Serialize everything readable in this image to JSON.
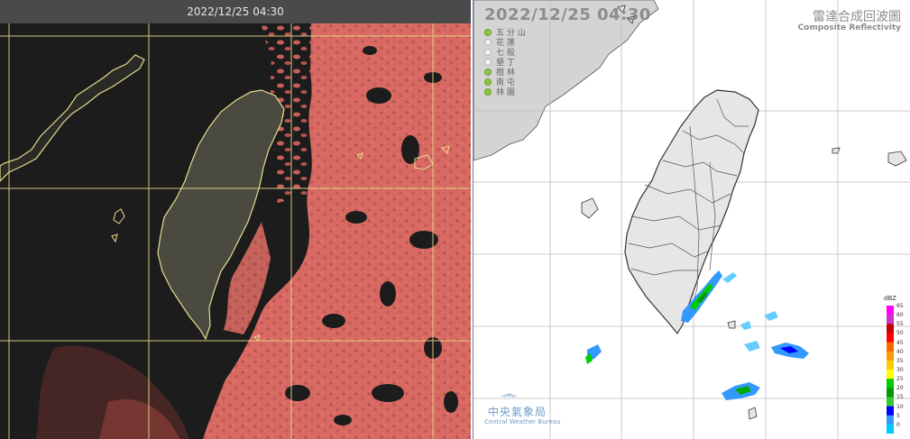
{
  "satellite": {
    "timestamp": "2022/12/25 04:30",
    "colors": {
      "background": "#1c1c1c",
      "land": "#4a4a40",
      "coastline": "#e6dc8c",
      "grid": "#e6dc8c",
      "cloud": "#d96a63",
      "cloud_dark": "#a8504a"
    }
  },
  "radar": {
    "timestamp": "2022/12/25  04:30",
    "title_zh": "雷達合成回波圖",
    "title_en": "Composite Reflectivity",
    "stations": [
      {
        "name": "五 分 山",
        "active": true
      },
      {
        "name": "花 蓮",
        "active": false
      },
      {
        "name": "七 股",
        "active": false
      },
      {
        "name": "墾 丁",
        "active": false
      },
      {
        "name": "樹 林",
        "active": true
      },
      {
        "name": "南 屯",
        "active": true
      },
      {
        "name": "林 園",
        "active": true
      }
    ],
    "agency_zh": "中央氣象局",
    "agency_en": "Central Weather Bureau",
    "scale_unit": "dBZ",
    "scale_values": [
      "65",
      "60",
      "55",
      "50",
      "45",
      "40",
      "35",
      "30",
      "25",
      "20",
      "15",
      "10",
      "5",
      "0"
    ],
    "scale_colors": [
      "#ff00ff",
      "#cc33cc",
      "#c80000",
      "#ff0000",
      "#ff6600",
      "#ff9900",
      "#ffcc00",
      "#ffff00",
      "#00cc00",
      "#009900",
      "#33cc33",
      "#0000ff",
      "#3399ff",
      "#00ccff"
    ],
    "colors": {
      "land": "#e6e6e6",
      "border": "#333333",
      "grid": "#bdbdbd",
      "mainland": "#d4d4d4"
    }
  }
}
